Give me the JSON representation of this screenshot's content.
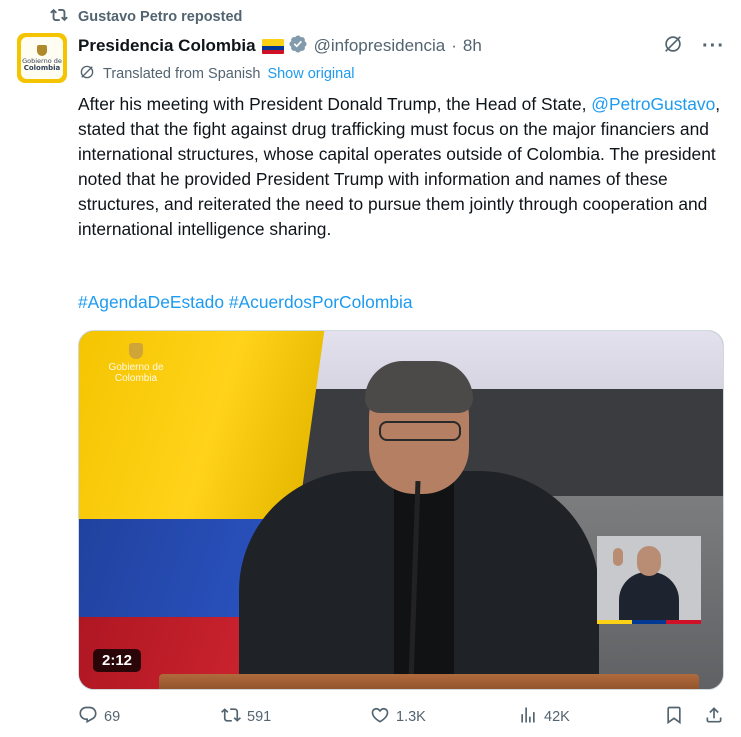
{
  "repost": {
    "text": "Gustavo Petro reposted",
    "icon": "repost-icon"
  },
  "author": {
    "name": "Presidencia Colombia",
    "handle": "@infopresidencia",
    "separator": "·",
    "time": "8h",
    "avatar_text_line1": "Gobierno de",
    "avatar_text_line2": "Colombia",
    "verified_color": "#829aab"
  },
  "translation": {
    "label": "Translated from Spanish",
    "link": "Show original"
  },
  "tweet": {
    "text_part1": "After his meeting with President Donald Trump, the Head of State, ",
    "mention": "@PetroGustavo",
    "text_part2": ", stated that the fight against drug trafficking must focus on the major financiers and international structures, whose capital operates outside of Colombia. The president noted that he provided President Trump with information and names of these structures, and reiterated the need to pursue them jointly through cooperation and international intelligence sharing.",
    "hashtag1": "#AgendaDeEstado",
    "hashtag2": "#AcuerdosPorColombia"
  },
  "media": {
    "watermark_line1": "Gobierno de",
    "watermark_line2": "Colombia",
    "duration": "2:12"
  },
  "actions": {
    "replies": "69",
    "reposts": "591",
    "likes": "1.3K",
    "views": "42K"
  },
  "colors": {
    "link": "#1d9bf0",
    "muted": "#536471",
    "text": "#0f1419"
  }
}
